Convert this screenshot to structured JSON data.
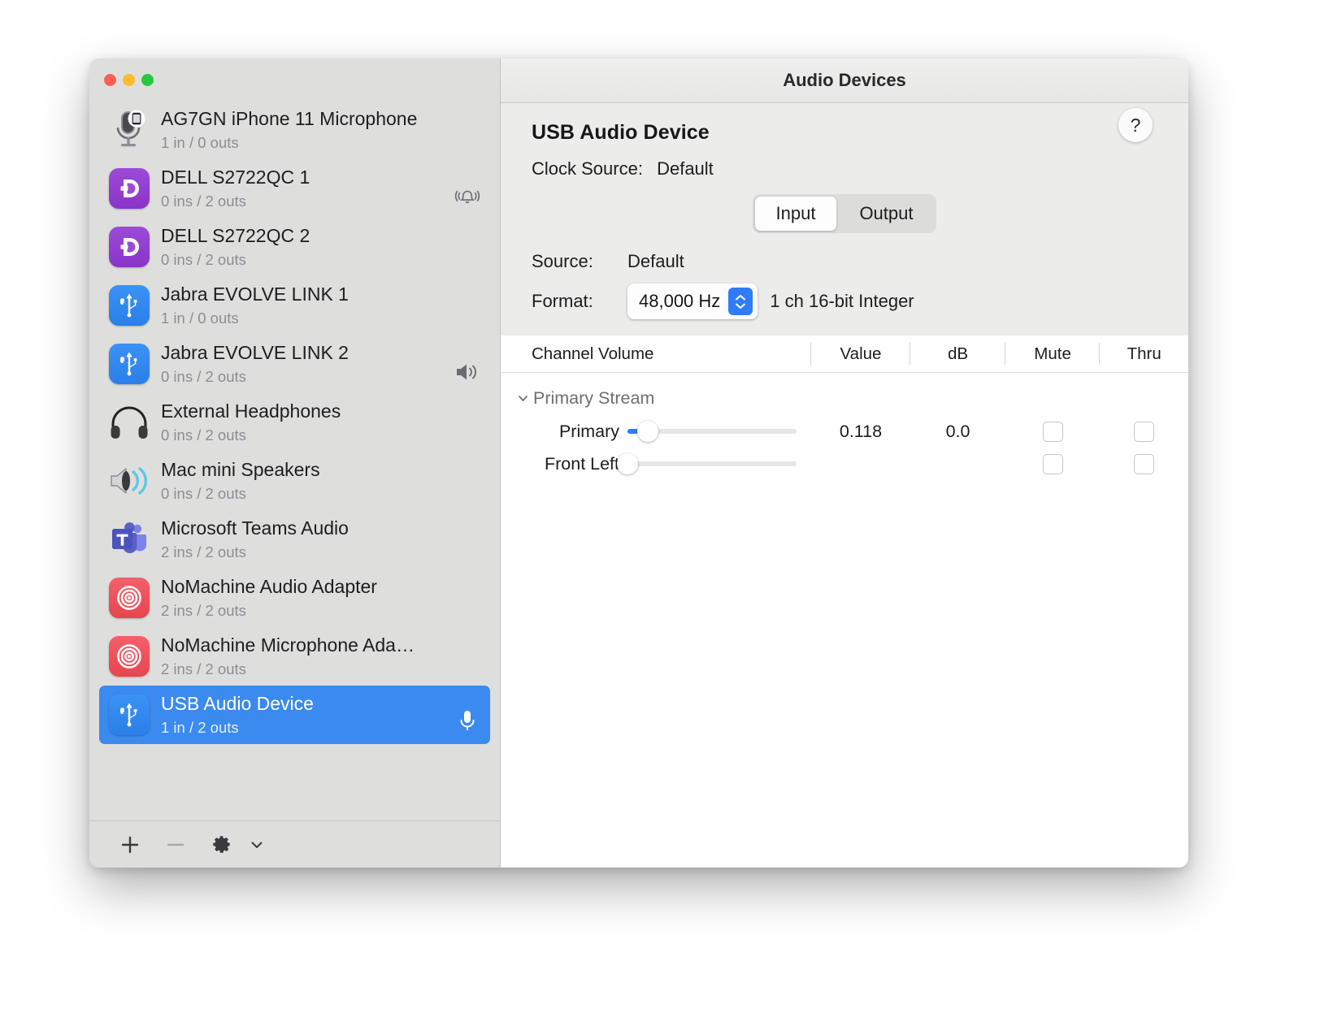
{
  "window": {
    "title": "Audio Devices",
    "traffic_lights": [
      "close",
      "minimize",
      "zoom"
    ]
  },
  "sidebar": {
    "devices": [
      {
        "name": "AG7GN iPhone 11 Microphone",
        "channels": "1 in / 0 outs",
        "icon": "microphone-iphone-icon",
        "status_icon": "",
        "selected": false
      },
      {
        "name": "DELL S2722QC 1",
        "channels": "0 ins / 2 outs",
        "icon": "displayport-icon",
        "status_icon": "alert-bell-icon",
        "selected": false
      },
      {
        "name": "DELL S2722QC 2",
        "channels": "0 ins / 2 outs",
        "icon": "displayport-icon",
        "status_icon": "",
        "selected": false
      },
      {
        "name": "Jabra EVOLVE LINK 1",
        "channels": "1 in / 0 outs",
        "icon": "usb-icon",
        "status_icon": "",
        "selected": false
      },
      {
        "name": "Jabra EVOLVE LINK 2",
        "channels": "0 ins / 2 outs",
        "icon": "usb-icon",
        "status_icon": "speaker-icon",
        "selected": false
      },
      {
        "name": "External Headphones",
        "channels": "0 ins / 2 outs",
        "icon": "headphones-icon",
        "status_icon": "",
        "selected": false
      },
      {
        "name": "Mac mini Speakers",
        "channels": "0 ins / 2 outs",
        "icon": "speaker-waves-icon",
        "status_icon": "",
        "selected": false
      },
      {
        "name": "Microsoft Teams Audio",
        "channels": "2 ins / 2 outs",
        "icon": "teams-icon",
        "status_icon": "",
        "selected": false
      },
      {
        "name": "NoMachine Audio Adapter",
        "channels": "2 ins / 2 outs",
        "icon": "nomachine-icon",
        "status_icon": "",
        "selected": false
      },
      {
        "name": "NoMachine Microphone Ada…",
        "channels": "2 ins / 2 outs",
        "icon": "nomachine-icon",
        "status_icon": "",
        "selected": false
      },
      {
        "name": "USB Audio Device",
        "channels": "1 in / 2 outs",
        "icon": "usb-icon",
        "status_icon": "microphone-icon",
        "selected": true
      }
    ],
    "toolbar": {
      "add": "+",
      "remove": "−",
      "gear": "gear-icon",
      "chevron": "chevron-down-icon"
    }
  },
  "detail": {
    "device_name": "USB Audio Device",
    "clock_source_label": "Clock Source:",
    "clock_source_value": "Default",
    "help_label": "?",
    "tabs": [
      {
        "label": "Input",
        "active": true
      },
      {
        "label": "Output",
        "active": false
      }
    ],
    "source_label": "Source:",
    "source_value": "Default",
    "format_label": "Format:",
    "format_rate": "48,000 Hz",
    "format_desc": "1 ch 16-bit Integer",
    "table": {
      "headers": {
        "channel": "Channel Volume",
        "value": "Value",
        "db": "dB",
        "mute": "Mute",
        "thru": "Thru"
      },
      "group": "Primary Stream",
      "rows": [
        {
          "name": "Primary",
          "slider": 0.118,
          "value": "0.118",
          "db": "0.0",
          "mute": false,
          "thru": false
        },
        {
          "name": "Front Left",
          "slider": 0.0,
          "value": "",
          "db": "",
          "mute": false,
          "thru": false
        }
      ]
    }
  },
  "colors": {
    "accent": "#2f7cf6",
    "selection": "#3b8aef",
    "sidebar_bg": "#dedfdd",
    "panel_bg": "#ececea",
    "table_bg": "#ffffff"
  }
}
